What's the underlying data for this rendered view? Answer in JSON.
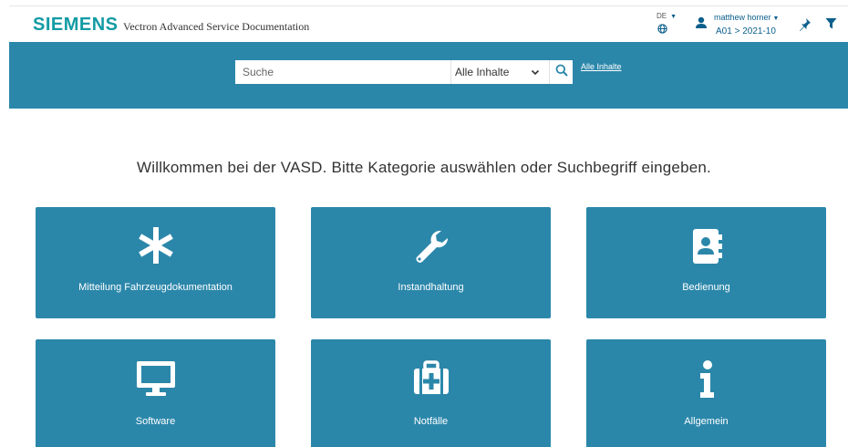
{
  "header": {
    "logo": "SIEMENS",
    "app_title": "Vectron Advanced Service Documentation",
    "language": "DE",
    "user_name": "matthew horner",
    "user_context": "A01 > 2021-10",
    "icons": [
      "globe-icon",
      "user-icon",
      "pin-icon",
      "filter-icon"
    ]
  },
  "search": {
    "placeholder": "Suche",
    "scope_selected": "Alle Inhalte",
    "scope_link": "Alle Inhalte"
  },
  "welcome_text": "Willkommen bei der VASD. Bitte Kategorie auswählen oder Suchbegriff eingeben.",
  "categories": [
    {
      "label": "Mitteilung Fahrzeugdokumentation",
      "icon": "asterisk-icon"
    },
    {
      "label": "Instandhaltung",
      "icon": "wrench-icon"
    },
    {
      "label": "Bedienung",
      "icon": "contact-book-icon"
    },
    {
      "label": "Software",
      "icon": "monitor-icon"
    },
    {
      "label": "Notfälle",
      "icon": "medkit-icon"
    },
    {
      "label": "Allgemein",
      "icon": "info-icon"
    }
  ],
  "colors": {
    "brand": "#139ba4",
    "band": "#2b87aa",
    "tile": "#2b87aa",
    "link": "#0b5f8c"
  }
}
